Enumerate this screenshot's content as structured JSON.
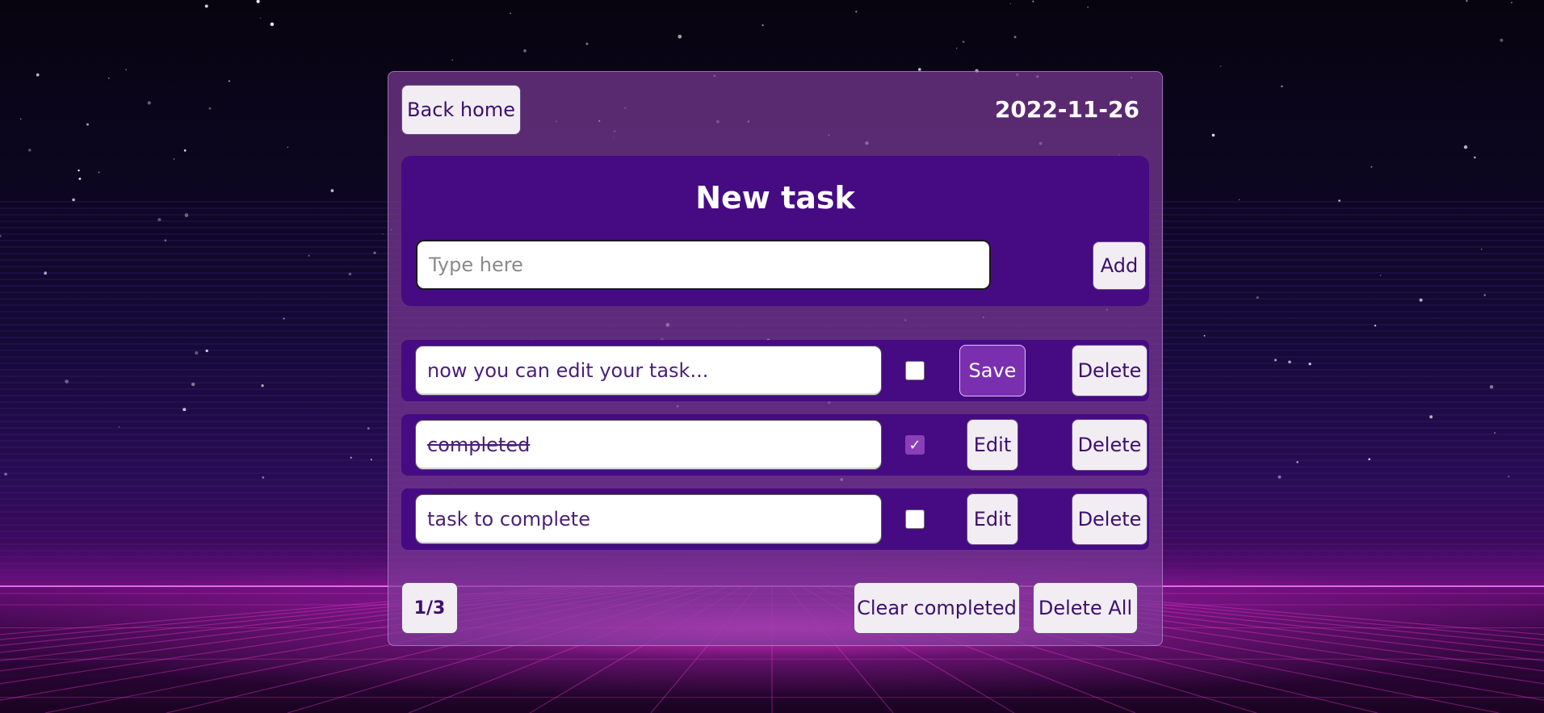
{
  "header": {
    "back_label": "Back home",
    "date": "2022-11-26"
  },
  "new_task": {
    "title": "New task",
    "placeholder": "Type here",
    "add_label": "Add"
  },
  "tasks": [
    {
      "text": "now you can edit your task...",
      "completed": false,
      "action_label": "Save",
      "delete_label": "Delete"
    },
    {
      "text": "completed",
      "completed": true,
      "action_label": "Edit",
      "delete_label": "Delete"
    },
    {
      "text": "task to complete",
      "completed": false,
      "action_label": "Edit",
      "delete_label": "Delete"
    }
  ],
  "footer": {
    "counter": "1/3",
    "clear_label": "Clear completed",
    "delete_all_label": "Delete All"
  },
  "icons": {
    "checkmark": "check-icon"
  },
  "colors": {
    "panel": "#460b83",
    "card": "#803c9b",
    "accent": "#8a3fb8",
    "button_bg": "#f1edf3",
    "button_text": "#3d0f6e"
  }
}
